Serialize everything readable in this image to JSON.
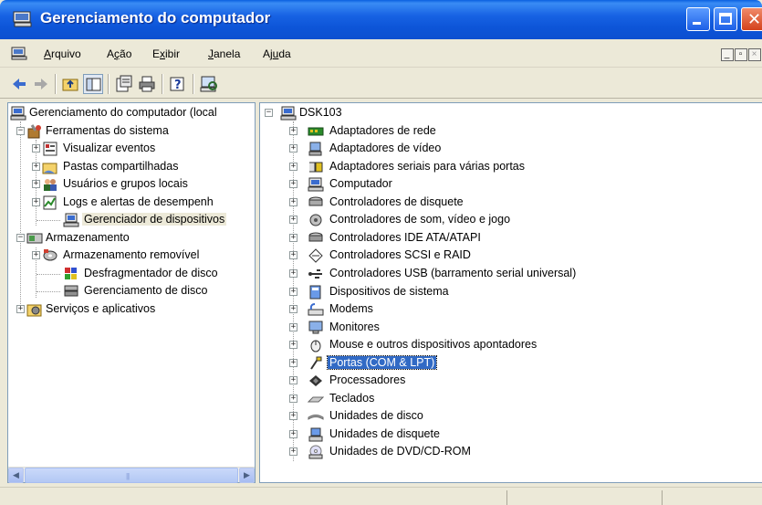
{
  "window": {
    "title": "Gerenciamento do computador"
  },
  "menu": [
    {
      "pre": "",
      "u": "A",
      "post": "rquivo"
    },
    {
      "pre": "A",
      "u": "ç",
      "post": "ão"
    },
    {
      "pre": "E",
      "u": "x",
      "post": "ibir"
    },
    {
      "pre": "",
      "u": "J",
      "post": "anela"
    },
    {
      "pre": "Aj",
      "u": "u",
      "post": "da"
    }
  ],
  "left_tree": [
    {
      "label": "Gerenciamento do computador (local",
      "icon": "computer-icon"
    },
    {
      "label": "Ferramentas do sistema",
      "icon": "tools-icon"
    },
    {
      "label": "Visualizar eventos",
      "icon": "event-viewer-icon"
    },
    {
      "label": "Pastas compartilhadas",
      "icon": "shared-folder-icon"
    },
    {
      "label": "Usuários e grupos locais",
      "icon": "users-icon"
    },
    {
      "label": "Logs e alertas de desempenh",
      "icon": "performance-logs-icon"
    },
    {
      "label": "Gerenciador de dispositivos",
      "icon": "device-manager-icon"
    },
    {
      "label": "Armazenamento",
      "icon": "storage-icon"
    },
    {
      "label": "Armazenamento removível",
      "icon": "removable-storage-icon"
    },
    {
      "label": "Desfragmentador de disco",
      "icon": "defrag-icon"
    },
    {
      "label": "Gerenciamento de disco",
      "icon": "disk-management-icon"
    },
    {
      "label": "Serviços e aplicativos",
      "icon": "services-icon"
    }
  ],
  "right_tree": {
    "root": "DSK103",
    "items": [
      {
        "label": "Adaptadores de rede",
        "icon": "network-adapter-icon"
      },
      {
        "label": "Adaptadores de vídeo",
        "icon": "display-adapter-icon"
      },
      {
        "label": "Adaptadores seriais para várias portas",
        "icon": "multiport-serial-icon"
      },
      {
        "label": "Computador",
        "icon": "computer-icon"
      },
      {
        "label": "Controladores de disquete",
        "icon": "floppy-controller-icon"
      },
      {
        "label": "Controladores de som, vídeo e jogo",
        "icon": "sound-icon"
      },
      {
        "label": "Controladores IDE ATA/ATAPI",
        "icon": "ide-controller-icon"
      },
      {
        "label": "Controladores SCSI e RAID",
        "icon": "scsi-icon"
      },
      {
        "label": "Controladores USB (barramento serial universal)",
        "icon": "usb-icon"
      },
      {
        "label": "Dispositivos de sistema",
        "icon": "system-device-icon"
      },
      {
        "label": "Modems",
        "icon": "modem-icon"
      },
      {
        "label": "Monitores",
        "icon": "monitor-icon"
      },
      {
        "label": "Mouse e outros dispositivos apontadores",
        "icon": "mouse-icon"
      },
      {
        "label": "Portas (COM & LPT)",
        "icon": "port-icon"
      },
      {
        "label": "Processadores",
        "icon": "processor-icon"
      },
      {
        "label": "Teclados",
        "icon": "keyboard-icon"
      },
      {
        "label": "Unidades de disco",
        "icon": "disk-drive-icon"
      },
      {
        "label": "Unidades de disquete",
        "icon": "floppy-drive-icon"
      },
      {
        "label": "Unidades de DVD/CD-ROM",
        "icon": "dvd-drive-icon"
      }
    ]
  },
  "colors": {
    "title_blue": "#0b56d8",
    "selection_blue": "#316ac5",
    "chrome": "#ece9d8"
  }
}
